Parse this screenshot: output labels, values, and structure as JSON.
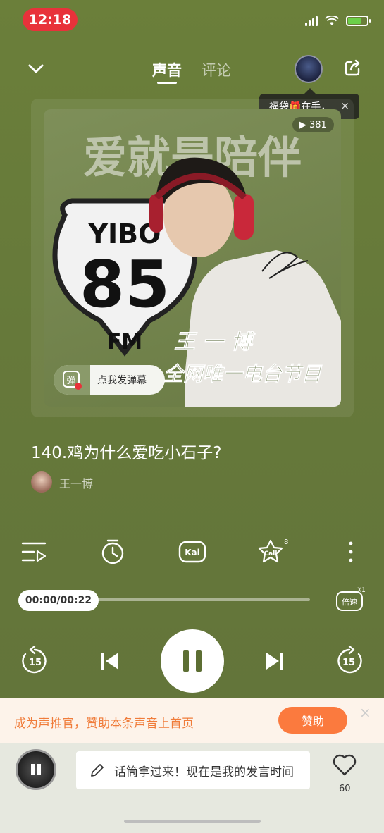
{
  "status_bar": {
    "time": "12:18"
  },
  "nav": {
    "tab_sound": "声音",
    "tab_comment": "评论"
  },
  "tooltip": {
    "text": "福袋🎁在手，",
    "close": "×"
  },
  "cover": {
    "play_count": "381",
    "banner_text": "爱就是陪伴",
    "sign_top": "YIBO",
    "sign_number": "85",
    "sign_bottom": "FM",
    "artist_overlay": "王 一 博",
    "slogan": "全网唯一电台节目",
    "danmu_icon_text": "弹",
    "danmu_label": "点我发弹幕"
  },
  "track": {
    "title": "140.鸡为什么爱吃小石子?",
    "author": "王一博"
  },
  "actions": {
    "kai_label": "Kai",
    "call_label": "Call",
    "call_badge": "8"
  },
  "progress": {
    "time": "00:00/00:22",
    "fraction": 0.0,
    "speed_label": "倍速",
    "speed_value": "X1"
  },
  "controls": {
    "rewind_seconds": "15",
    "forward_seconds": "15"
  },
  "promo": {
    "text": "成为声推官，赞助本条声音上首页",
    "button": "赞助",
    "close": "×"
  },
  "bottom": {
    "comment_placeholder": "话筒拿过来！现在是我的发言时间",
    "like_count": "60"
  },
  "colors": {
    "background": "#66793a",
    "accent": "#fb7a3e",
    "promo_text": "#f07c3a",
    "time_pill": "#e8323a"
  }
}
